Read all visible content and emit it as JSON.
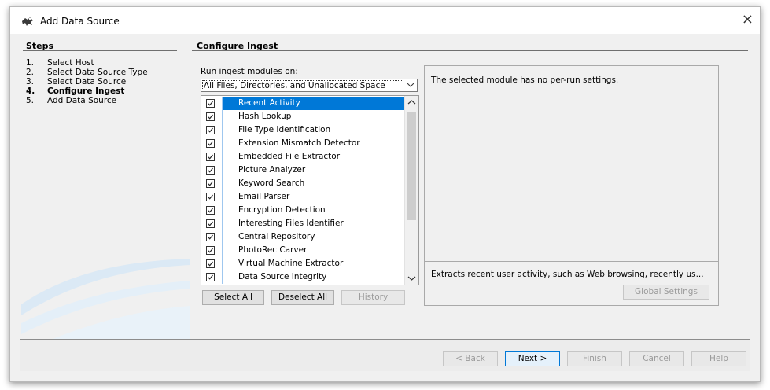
{
  "window": {
    "title": "Add Data Source",
    "close_glyph": "×"
  },
  "steps": {
    "heading": "Steps",
    "items": [
      {
        "num": "1.",
        "label": "Select Host"
      },
      {
        "num": "2.",
        "label": "Select Data Source Type"
      },
      {
        "num": "3.",
        "label": "Select Data Source"
      },
      {
        "num": "4.",
        "label": "Configure Ingest"
      },
      {
        "num": "5.",
        "label": "Add Data Source"
      }
    ],
    "active_index": 3
  },
  "configure": {
    "heading": "Configure Ingest",
    "run_label": "Run ingest modules on:",
    "run_value": "All Files, Directories, and Unallocated Space",
    "modules": [
      {
        "label": "Recent Activity",
        "checked": true,
        "selected": true
      },
      {
        "label": "Hash Lookup",
        "checked": true
      },
      {
        "label": "File Type Identification",
        "checked": true
      },
      {
        "label": "Extension Mismatch Detector",
        "checked": true
      },
      {
        "label": "Embedded File Extractor",
        "checked": true
      },
      {
        "label": "Picture Analyzer",
        "checked": true
      },
      {
        "label": "Keyword Search",
        "checked": true
      },
      {
        "label": "Email Parser",
        "checked": true
      },
      {
        "label": "Encryption Detection",
        "checked": true
      },
      {
        "label": "Interesting Files Identifier",
        "checked": true
      },
      {
        "label": "Central Repository",
        "checked": true
      },
      {
        "label": "PhotoRec Carver",
        "checked": true
      },
      {
        "label": "Virtual Machine Extractor",
        "checked": true
      },
      {
        "label": "Data Source Integrity",
        "checked": true
      }
    ],
    "buttons": {
      "select_all": "Select All",
      "deselect_all": "Deselect All",
      "history": "History"
    },
    "settings_message": "The selected module has no per-run settings.",
    "description": "Extracts recent user activity, such as Web browsing, recently us...",
    "global_settings": "Global Settings"
  },
  "footer": {
    "back": "< Back",
    "next": "Next >",
    "finish": "Finish",
    "cancel": "Cancel",
    "help": "Help"
  },
  "colors": {
    "selection": "#0078d7",
    "window_bg": "#f0f0f0",
    "swoosh": "#d6e6f3"
  }
}
